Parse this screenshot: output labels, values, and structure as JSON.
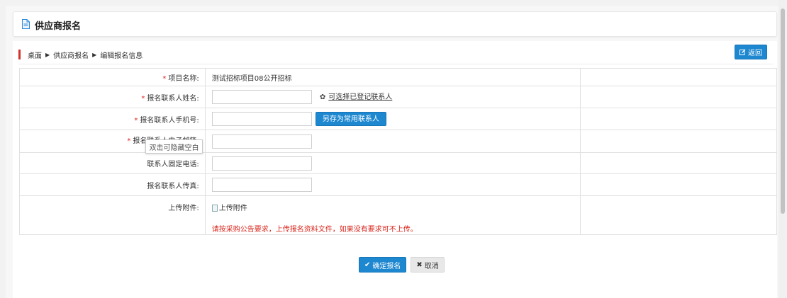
{
  "page": {
    "title": "供应商报名"
  },
  "breadcrumb": {
    "items": [
      "桌面",
      "供应商报名",
      "编辑报名信息"
    ],
    "separator": "▶"
  },
  "toolbar": {
    "back_label": "返回"
  },
  "form": {
    "rows": [
      {
        "label": "项目名称:",
        "required": "*",
        "value": "测试招标项目08公开招标"
      },
      {
        "label": "报名联系人姓名:",
        "required": "*",
        "input_value": "",
        "link": "可选择已登记联系人"
      },
      {
        "label": "报名联系人手机号:",
        "required": "*",
        "input_value": "",
        "button": "另存为常用联系人"
      },
      {
        "label": "报名联系人电子邮箱:",
        "required": "*",
        "input_value": ""
      },
      {
        "label": "联系人固定电话:",
        "required": "",
        "input_value": ""
      },
      {
        "label": "报名联系人传真:",
        "required": "",
        "input_value": ""
      },
      {
        "label": "上传附件:",
        "required": "",
        "upload": "上传附件",
        "notice": "请按采购公告要求，上传报名资料文件，如果没有要求可不上传。"
      }
    ]
  },
  "tooltip": {
    "text": "双击可隐藏空白"
  },
  "footer": {
    "confirm_label": "确定报名",
    "cancel_label": "取消"
  },
  "colors": {
    "primary": "#1d87d0",
    "required": "#e02020",
    "notice": "#d9261c",
    "crumb_mark": "#d0332c"
  }
}
